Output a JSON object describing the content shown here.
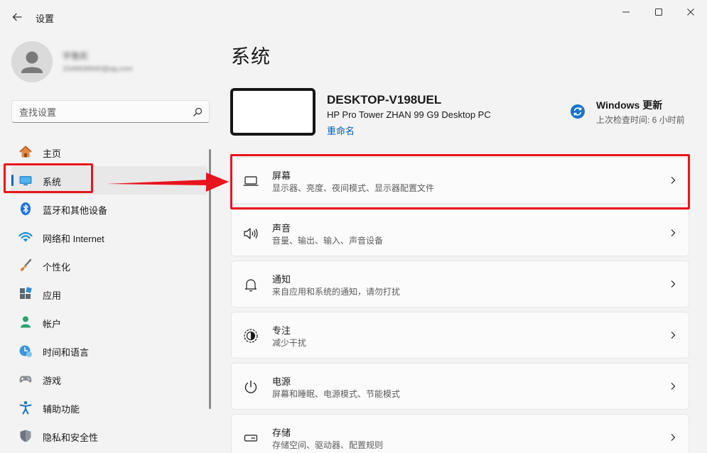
{
  "window": {
    "title": "设置"
  },
  "profile": {
    "name": "宇鲁民",
    "email": "1549938940@qq.com"
  },
  "search": {
    "placeholder": "查找设置"
  },
  "nav": {
    "items": [
      {
        "label": "主页",
        "icon": "home-icon"
      },
      {
        "label": "系统",
        "icon": "system-display-icon",
        "selected": true
      },
      {
        "label": "蓝牙和其他设备",
        "icon": "bluetooth-icon"
      },
      {
        "label": "网络和 Internet",
        "icon": "wifi-icon"
      },
      {
        "label": "个性化",
        "icon": "paintbrush-icon"
      },
      {
        "label": "应用",
        "icon": "apps-icon"
      },
      {
        "label": "帐户",
        "icon": "account-icon"
      },
      {
        "label": "时间和语言",
        "icon": "time-language-icon"
      },
      {
        "label": "游戏",
        "icon": "gamepad-icon"
      },
      {
        "label": "辅助功能",
        "icon": "accessibility-icon"
      },
      {
        "label": "隐私和安全性",
        "icon": "shield-icon"
      }
    ]
  },
  "main": {
    "page_title": "系统",
    "device": {
      "name": "DESKTOP-V198UEL",
      "model": "HP Pro Tower ZHAN 99 G9 Desktop PC",
      "rename_label": "重命名"
    },
    "update": {
      "title": "Windows 更新",
      "subtitle": "上次检查时间: 6 小时前"
    },
    "cards": [
      {
        "title": "屏幕",
        "subtitle": "显示器、亮度、夜间模式、显示器配置文件",
        "icon": "monitor-icon"
      },
      {
        "title": "声音",
        "subtitle": "音量、输出、输入、声音设备",
        "icon": "speaker-icon"
      },
      {
        "title": "通知",
        "subtitle": "来自应用和系统的通知，请勿打扰",
        "icon": "bell-icon"
      },
      {
        "title": "专注",
        "subtitle": "减少干扰",
        "icon": "focus-icon"
      },
      {
        "title": "电源",
        "subtitle": "屏幕和睡眠、电源模式、节能模式",
        "icon": "power-icon"
      },
      {
        "title": "存储",
        "subtitle": "存储空间、驱动器、配置规则",
        "icon": "storage-icon"
      }
    ]
  },
  "colors": {
    "accent": "#0067c0",
    "link": "#005fb8",
    "annotation": "#e8141c",
    "background": "#f3f3f3",
    "card": "#fbfbfb"
  }
}
